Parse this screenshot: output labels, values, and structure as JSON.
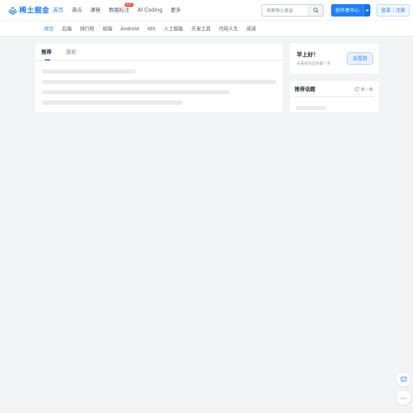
{
  "header": {
    "logo_text": "稀土掘金",
    "nav": [
      {
        "label": "首页",
        "active": true
      },
      {
        "label": "沸点"
      },
      {
        "label": "课程"
      },
      {
        "label": "数据标注",
        "badge": "HOT"
      },
      {
        "label": "AI Coding"
      },
      {
        "label": "更多"
      }
    ],
    "search_placeholder": "探索稀土掘金",
    "creator_label": "创作者中心",
    "login_label": "登录",
    "register_label": "注册"
  },
  "subnav": [
    "综合",
    "后端",
    "排行榜",
    "前端",
    "Android",
    "iOS",
    "人工智能",
    "开发工具",
    "代码人生",
    "阅读"
  ],
  "feed": {
    "tabs": [
      "推荐",
      "最新"
    ]
  },
  "sidebar": {
    "greeting": "早上好！",
    "greeting_sub": "点亮在社区的每一天",
    "signin_label": "去签到",
    "topics_title": "推荐话题",
    "refresh_label": "换一换"
  },
  "colors": {
    "accent": "#1e80ff",
    "background": "#f2f3f5",
    "hot_badge": "#ee502f"
  }
}
